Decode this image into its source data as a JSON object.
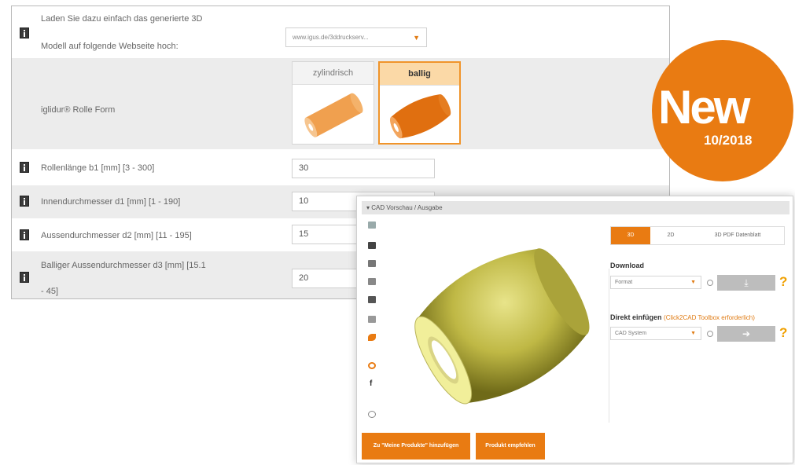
{
  "configurator": {
    "upload_label_line1": "Laden Sie dazu einfach das generierte 3D",
    "upload_label_line2": "Modell auf folgende Webseite hoch:",
    "upload_select_value": "www.igus.de/3ddruckserv...",
    "form_label": "iglidur® Rolle Form",
    "shape_options": [
      {
        "label": "zylindrisch",
        "selected": false
      },
      {
        "label": "ballig",
        "selected": true
      }
    ],
    "params": [
      {
        "label": "Rollenlänge b1 [mm] [3 - 300]",
        "value": "30"
      },
      {
        "label": "Innendurchmesser d1 [mm] [1 - 190]",
        "value": "10"
      },
      {
        "label": "Aussendurchmesser d2 [mm] [11 - 195]",
        "value": "15"
      },
      {
        "label_line1": "Balliger Aussendurchmesser d3 [mm] [15.1",
        "label_line2": "- 45]",
        "value": "20"
      }
    ]
  },
  "badge": {
    "text": "New",
    "date": "10/2018",
    "color": "#e97b12"
  },
  "cad_panel": {
    "header": "▾ CAD Vorschau / Ausgabe",
    "tabs": [
      {
        "label": "3D",
        "active": true
      },
      {
        "label": "2D",
        "active": false
      },
      {
        "label": "3D PDF Datenblatt",
        "active": false
      }
    ],
    "download": {
      "title": "Download",
      "select_value": "Format",
      "help": "?"
    },
    "direkt": {
      "title": "Direkt einfügen",
      "note": "(Click2CAD Toolbox erforderlich)",
      "select_value": "CAD System",
      "help": "?"
    },
    "buttons": {
      "add": "Zu \"Meine Produkte\" hinzufügen",
      "recommend": "Produkt empfehlen"
    },
    "model_color": "#c8c454"
  },
  "accent_color": "#e97b12"
}
